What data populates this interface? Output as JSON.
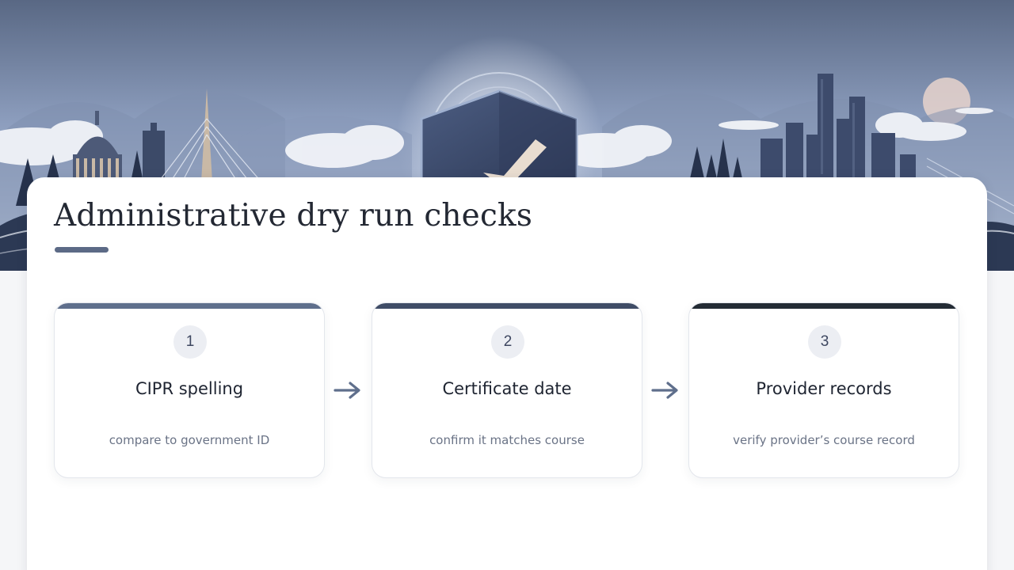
{
  "header": {
    "title": "Administrative dry run checks"
  },
  "colors": {
    "accent_underline": "#5c6a86",
    "step_1_accent": "#5f6f8c",
    "step_2_accent": "#3f4c66",
    "step_3_accent": "#232b34",
    "arrow": "#5f6f8c"
  },
  "steps": [
    {
      "number": "1",
      "title": "CIPR spelling",
      "description": "compare to government ID"
    },
    {
      "number": "2",
      "title": "Certificate date",
      "description": "confirm it matches course"
    },
    {
      "number": "3",
      "title": "Provider records",
      "description": "verify provider’s course record"
    }
  ],
  "icons": {
    "arrow_1": "arrow-right-icon",
    "arrow_2": "arrow-right-icon",
    "hero": "city-skyline-shield-check-illustration"
  }
}
